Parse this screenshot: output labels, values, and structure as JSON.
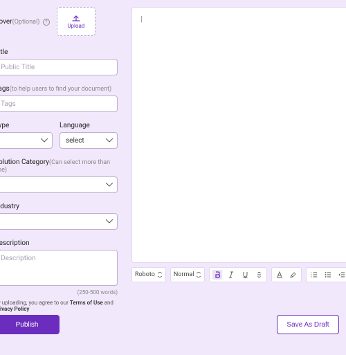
{
  "form": {
    "cover": {
      "label": "Cover",
      "optional": "(Optional)",
      "upload": "Upload"
    },
    "title": {
      "label": "Title",
      "placeholder": "Public Title"
    },
    "tags": {
      "label": "Tags",
      "hint": "(to help users to find your document)",
      "placeholder": "Tags"
    },
    "type": {
      "label": "Type"
    },
    "language": {
      "label": "Language",
      "placeholder": "select"
    },
    "solution": {
      "label": "Solution Category",
      "hint": "(Can select more than one)"
    },
    "industry": {
      "label": "Industry"
    },
    "description": {
      "label": "Description",
      "placeholder": "Description",
      "count": "(250-500 words)"
    },
    "agreement": {
      "pre": "By uploading, you agree to our ",
      "terms": "Terms of Use",
      "and": " and ",
      "privacy": "Privacy Policy"
    }
  },
  "editor": {
    "caret": "|",
    "font": "Roboto",
    "size": "Normal"
  },
  "buttons": {
    "publish": "Publish",
    "save": "Save As Draft"
  }
}
